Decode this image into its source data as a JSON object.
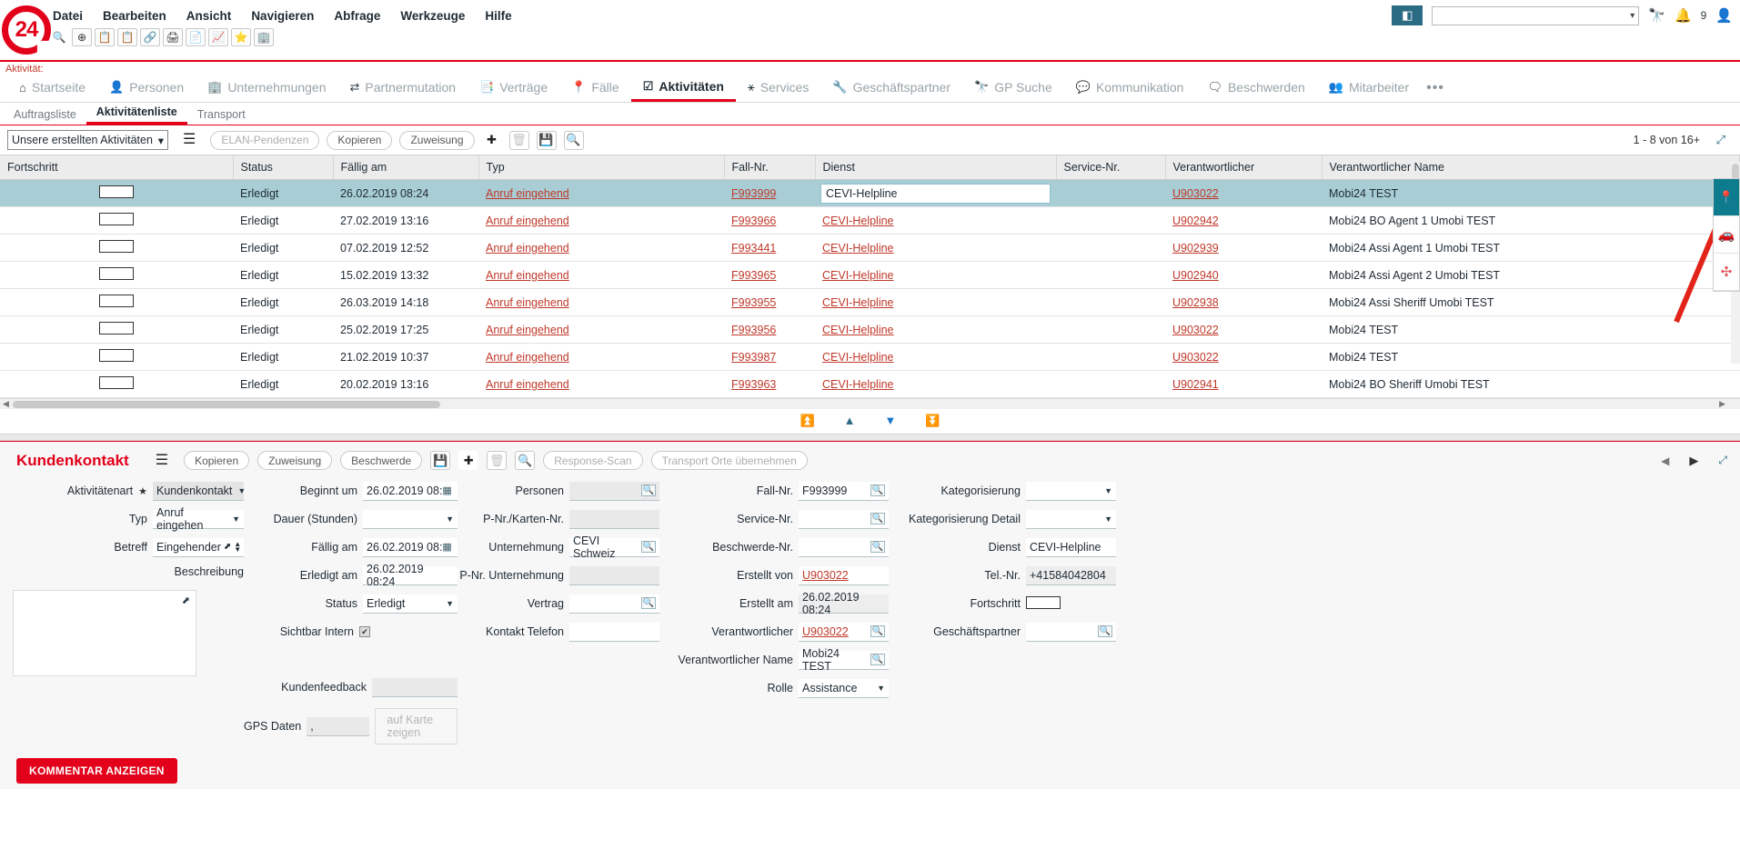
{
  "app": {
    "logo_text": "24",
    "menu": [
      "Datei",
      "Bearbeiten",
      "Ansicht",
      "Navigieren",
      "Abfrage",
      "Werkzeuge",
      "Hilfe"
    ],
    "toolbar_icons": [
      "search-icon",
      "goto-icon",
      "clipboard-check-icon",
      "clipboard-save-icon",
      "link-icon",
      "print-icon",
      "properties-icon",
      "chart-icon",
      "favorite-star-icon",
      "building-people-icon"
    ],
    "top_right": {
      "cube_icon": "cube-icon",
      "select_value": "",
      "binocular_icon": "binocular-icon",
      "bell_icon": "bell-icon",
      "bell_count": "9",
      "user_icon": "user-icon"
    }
  },
  "context_label": "Aktivität:",
  "mainnav": {
    "items": [
      {
        "label": "Startseite",
        "icon": "home-icon",
        "active": false
      },
      {
        "label": "Personen",
        "icon": "person-icon",
        "active": false
      },
      {
        "label": "Unternehmungen",
        "icon": "building-icon",
        "active": false
      },
      {
        "label": "Partnermutation",
        "icon": "shuffle-icon",
        "active": false
      },
      {
        "label": "Verträge",
        "icon": "contract-icon",
        "active": false
      },
      {
        "label": "Fälle",
        "icon": "pin-icon",
        "active": false
      },
      {
        "label": "Aktivitäten",
        "icon": "checkbox-icon",
        "active": true
      },
      {
        "label": "Services",
        "icon": "services-icon",
        "active": false
      },
      {
        "label": "Geschäftspartner",
        "icon": "wrench-icon",
        "active": false
      },
      {
        "label": "GP Suche",
        "icon": "binocular-icon",
        "active": false
      },
      {
        "label": "Kommunikation",
        "icon": "chat-icon",
        "active": false
      },
      {
        "label": "Beschwerden",
        "icon": "complaint-icon",
        "active": false
      },
      {
        "label": "Mitarbeiter",
        "icon": "employees-icon",
        "active": false
      }
    ],
    "overflow": "•••"
  },
  "subtabs": [
    {
      "label": "Auftragsliste",
      "active": false
    },
    {
      "label": "Aktivitätenliste",
      "active": true
    },
    {
      "label": "Transport",
      "active": false
    }
  ],
  "list_toolbar": {
    "view_select": "Unsere erstellten Aktivitäten",
    "menu_icon": "hamburger-icon",
    "buttons": [
      {
        "label": "ELAN-Pendenzen",
        "disabled": true
      },
      {
        "label": "Kopieren",
        "disabled": false
      },
      {
        "label": "Zuweisung",
        "disabled": false
      }
    ],
    "icon_buttons": [
      "plus-icon",
      "trash-icon",
      "save-icon",
      "search-icon"
    ],
    "pager_text": "1 - 8 von 16+",
    "expand_icon": "expand-icon"
  },
  "table": {
    "columns": [
      "Fortschritt",
      "Status",
      "Fällig am",
      "Typ",
      "Fall-Nr.",
      "Dienst",
      "Service-Nr.",
      "Verantwortlicher",
      "Verantwortlicher Name"
    ],
    "rows": [
      {
        "fortschritt": "",
        "status": "Erledigt",
        "faellig": "26.02.2019 08:24",
        "typ": "Anruf eingehend",
        "fallnr": "F993999",
        "dienst": "CEVI-Helpline",
        "servicenr": "",
        "verantwortlicher": "U903022",
        "name": "Mobi24 TEST",
        "selected": true,
        "editing": true
      },
      {
        "fortschritt": "",
        "status": "Erledigt",
        "faellig": "27.02.2019 13:16",
        "typ": "Anruf eingehend",
        "fallnr": "F993966",
        "dienst": "CEVI-Helpline",
        "servicenr": "",
        "verantwortlicher": "U902942",
        "name": "Mobi24 BO Agent 1 Umobi TEST",
        "selected": false,
        "editing": false
      },
      {
        "fortschritt": "",
        "status": "Erledigt",
        "faellig": "07.02.2019 12:52",
        "typ": "Anruf eingehend",
        "fallnr": "F993441",
        "dienst": "CEVI-Helpline",
        "servicenr": "",
        "verantwortlicher": "U902939",
        "name": "Mobi24 Assi Agent 1 Umobi TEST",
        "selected": false,
        "editing": false
      },
      {
        "fortschritt": "",
        "status": "Erledigt",
        "faellig": "15.02.2019 13:32",
        "typ": "Anruf eingehend",
        "fallnr": "F993965",
        "dienst": "CEVI-Helpline",
        "servicenr": "",
        "verantwortlicher": "U902940",
        "name": "Mobi24 Assi Agent 2 Umobi TEST",
        "selected": false,
        "editing": false
      },
      {
        "fortschritt": "",
        "status": "Erledigt",
        "faellig": "26.03.2019 14:18",
        "typ": "Anruf eingehend",
        "fallnr": "F993955",
        "dienst": "CEVI-Helpline",
        "servicenr": "",
        "verantwortlicher": "U902938",
        "name": "Mobi24 Assi Sheriff Umobi TEST",
        "selected": false,
        "editing": false
      },
      {
        "fortschritt": "",
        "status": "Erledigt",
        "faellig": "25.02.2019 17:25",
        "typ": "Anruf eingehend",
        "fallnr": "F993956",
        "dienst": "CEVI-Helpline",
        "servicenr": "",
        "verantwortlicher": "U903022",
        "name": "Mobi24 TEST",
        "selected": false,
        "editing": false
      },
      {
        "fortschritt": "",
        "status": "Erledigt",
        "faellig": "21.02.2019 10:37",
        "typ": "Anruf eingehend",
        "fallnr": "F993987",
        "dienst": "CEVI-Helpline",
        "servicenr": "",
        "verantwortlicher": "U903022",
        "name": "Mobi24 TEST",
        "selected": false,
        "editing": false
      },
      {
        "fortschritt": "",
        "status": "Erledigt",
        "faellig": "20.02.2019 13:16",
        "typ": "Anruf eingehend",
        "fallnr": "F993963",
        "dienst": "CEVI-Helpline",
        "servicenr": "",
        "verantwortlicher": "U902941",
        "name": "Mobi24 BO Sheriff Umobi TEST",
        "selected": false,
        "editing": false
      }
    ],
    "nav_arrows": [
      "first-icon",
      "up-icon",
      "down-icon",
      "last-icon"
    ]
  },
  "detail": {
    "title": "Kundenkontakt",
    "menu_icon": "hamburger-icon",
    "buttons": [
      {
        "label": "Kopieren",
        "disabled": false
      },
      {
        "label": "Zuweisung",
        "disabled": false
      },
      {
        "label": "Beschwerde",
        "disabled": false
      }
    ],
    "icon_buttons": [
      "save-icon",
      "plus-icon",
      "trash-icon",
      "search-icon"
    ],
    "disabled_buttons": [
      {
        "label": "Response-Scan"
      },
      {
        "label": "Transport Orte übernehmen"
      }
    ],
    "nav": {
      "prev": "prev-icon",
      "next": "next-icon",
      "expand": "expand-icon"
    },
    "col1": [
      {
        "label": "Aktivitätenart",
        "required": true,
        "value": "Kundenkontakt",
        "type": "select"
      },
      {
        "label": "Typ",
        "required": false,
        "value": "Anruf eingehen",
        "type": "select"
      },
      {
        "label": "Betreff",
        "required": false,
        "value": "Eingehender",
        "type": "spinner"
      },
      {
        "label": "Beschreibung",
        "required": false,
        "value": "",
        "type": "textarea"
      }
    ],
    "col2": [
      {
        "label": "Beginnt um",
        "value": "26.02.2019  08:",
        "type": "date"
      },
      {
        "label": "Dauer (Stunden)",
        "value": "",
        "type": "select"
      },
      {
        "label": "Fällig am",
        "value": "26.02.2019  08:",
        "type": "date"
      },
      {
        "label": "Erledigt am",
        "value": "26.02.2019  08:24",
        "type": "text"
      },
      {
        "label": "Status",
        "value": "Erledigt",
        "type": "select"
      },
      {
        "label": "Sichtbar Intern",
        "value": "checked",
        "type": "checkbox"
      },
      {
        "label": "Kundenfeedback",
        "value": "",
        "type": "text-gray"
      },
      {
        "label": "GPS Daten",
        "value": ",",
        "type": "text-gray-btn",
        "button": "auf Karte zeigen"
      }
    ],
    "col3": [
      {
        "label": "Personen",
        "value": "",
        "type": "lookup-gray"
      },
      {
        "label": "P-Nr./Karten-Nr.",
        "value": "",
        "type": "text-gray"
      },
      {
        "label": "Unternehmung",
        "value": "CEVI Schweiz",
        "type": "lookup"
      },
      {
        "label": "P-Nr. Unternehmung",
        "value": "",
        "type": "text-gray"
      },
      {
        "label": "Vertrag",
        "value": "",
        "type": "lookup"
      },
      {
        "label": "Kontakt Telefon",
        "value": "",
        "type": "text"
      }
    ],
    "col4": [
      {
        "label": "Fall-Nr.",
        "value": "F993999",
        "type": "lookup"
      },
      {
        "label": "Service-Nr.",
        "value": "",
        "type": "lookup"
      },
      {
        "label": "Beschwerde-Nr.",
        "value": "",
        "type": "lookup"
      },
      {
        "label": "Erstellt von",
        "value": "U903022",
        "type": "link"
      },
      {
        "label": "Erstellt am",
        "value": "26.02.2019  08:24",
        "type": "text-gray"
      },
      {
        "label": "Verantwortlicher",
        "value": "U903022",
        "type": "link-lookup"
      },
      {
        "label": "Verantwortlicher Name",
        "value": "Mobi24 TEST",
        "type": "lookup"
      },
      {
        "label": "Rolle",
        "value": "Assistance",
        "type": "select"
      }
    ],
    "col5": [
      {
        "label": "Kategorisierung",
        "value": "",
        "type": "select"
      },
      {
        "label": "Kategorisierung Detail",
        "value": "",
        "type": "select"
      },
      {
        "label": "Dienst",
        "value": "CEVI-Helpline",
        "type": "text"
      },
      {
        "label": "Tel.-Nr.",
        "value": "+41584042804",
        "type": "text-gray"
      },
      {
        "label": "Fortschritt",
        "value": "",
        "type": "progress"
      },
      {
        "label": "Geschäftspartner",
        "value": "",
        "type": "lookup"
      }
    ],
    "comment_button": "KOMMENTAR ANZEIGEN"
  },
  "right_tools": [
    {
      "icon": "location-pin-icon",
      "active": true
    },
    {
      "icon": "car-icon",
      "active": false
    },
    {
      "icon": "bandage-icon",
      "active": false
    }
  ],
  "colors": {
    "brand_red": "#e2001a",
    "link_red": "#c0392b",
    "selected_row": "#a8cdd5",
    "teal": "#0f7b8f"
  }
}
